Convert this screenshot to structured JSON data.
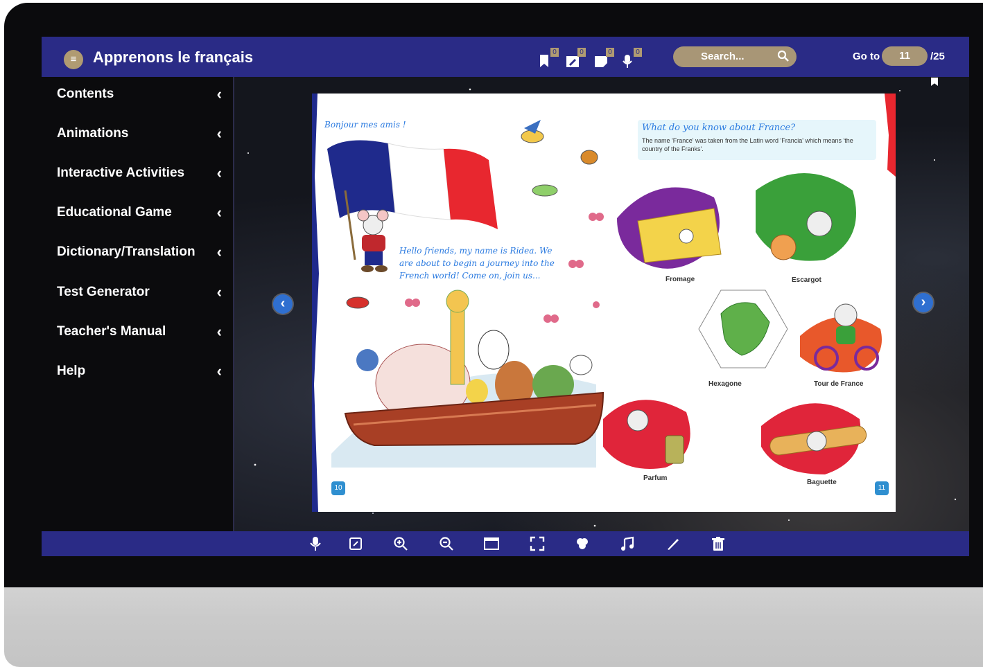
{
  "header": {
    "menu_icon": "hamburger-icon",
    "title": "Apprenons le français",
    "tool_badges": [
      {
        "icon": "bookmark-icon",
        "count": "0"
      },
      {
        "icon": "pencil-note-icon",
        "count": "0"
      },
      {
        "icon": "sticky-note-icon",
        "count": "0"
      },
      {
        "icon": "microphone-icon",
        "count": "0"
      }
    ],
    "search_placeholder": "Search...",
    "goto_label": "Go to",
    "current_page": "11",
    "total_pages": "/25"
  },
  "sidebar": {
    "items": [
      {
        "label": "Contents"
      },
      {
        "label": "Animations"
      },
      {
        "label": "Interactive Activities"
      },
      {
        "label": "Educational Game"
      },
      {
        "label": "Dictionary/Translation"
      },
      {
        "label": "Test Generator"
      },
      {
        "label": "Teacher's Manual"
      },
      {
        "label": "Help"
      }
    ],
    "chevron": "‹"
  },
  "page": {
    "greeting": "Bonjour mes amis !",
    "intro": "Hello friends, my name is Ridea. We are about to begin a journey into the French world! Come on, join us...",
    "info_title": "What do you know about France?",
    "info_text": "The name 'France' was taken from the Latin word 'Francia' which means 'the country of the Franks'.",
    "captions": [
      "Fromage",
      "Escargot",
      "Hexagone",
      "Tour de France",
      "Parfum",
      "Baguette"
    ],
    "left_page_number": "10",
    "right_page_number": "11",
    "colors": {
      "flag_blue": "#1f2a8c",
      "flag_red": "#e8272f",
      "link_blue": "#2a7ae0"
    }
  },
  "toolbar": {
    "icons": [
      "microphone-icon",
      "edit-icon",
      "zoom-in-icon",
      "zoom-out-icon",
      "window-icon",
      "fullscreen-icon",
      "color-palette-icon",
      "music-note-icon",
      "pen-icon",
      "trash-icon"
    ]
  },
  "theme": {
    "bar_color": "#2a2b86",
    "accent_tan": "#a89676"
  }
}
